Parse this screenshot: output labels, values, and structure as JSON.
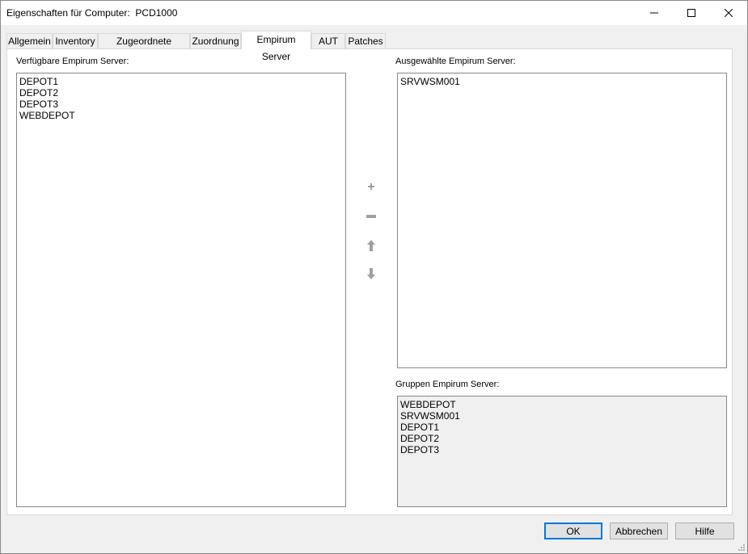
{
  "window": {
    "title": "Eigenschaften für Computer:  PCD1000",
    "minimize_icon": "minimize-icon",
    "maximize_icon": "maximize-icon",
    "close_icon": "close-icon"
  },
  "tabs": [
    {
      "label": "Allgemein"
    },
    {
      "label": "Inventory"
    },
    {
      "label": "Zugeordnete Objekte"
    },
    {
      "label": "Zuordnung"
    },
    {
      "label": "Empirum Server",
      "active": true
    },
    {
      "label": "AUT"
    },
    {
      "label": "Patches"
    }
  ],
  "available": {
    "label": "Verfügbare Empirum Server:",
    "items": [
      "DEPOT1",
      "DEPOT2",
      "DEPOT3",
      "WEBDEPOT"
    ]
  },
  "selected": {
    "label": "Ausgewählte Empirum Server:",
    "items": [
      "SRVWSM001"
    ]
  },
  "group": {
    "label": "Gruppen Empirum Server:",
    "items": [
      "WEBDEPOT",
      "SRVWSM001",
      "DEPOT1",
      "DEPOT2",
      "DEPOT3"
    ]
  },
  "side_buttons": {
    "add_icon": "plus-icon",
    "remove_icon": "minus-icon",
    "up_icon": "arrow-up-icon",
    "down_icon": "arrow-down-icon",
    "disabled_color": "#a0a0a0"
  },
  "buttons": {
    "ok": "OK",
    "cancel": "Abbrechen",
    "help": "Hilfe"
  },
  "colors": {
    "accent": "#0078d7",
    "list_border": "#828790",
    "dialog_bg": "#f0f0f0"
  }
}
